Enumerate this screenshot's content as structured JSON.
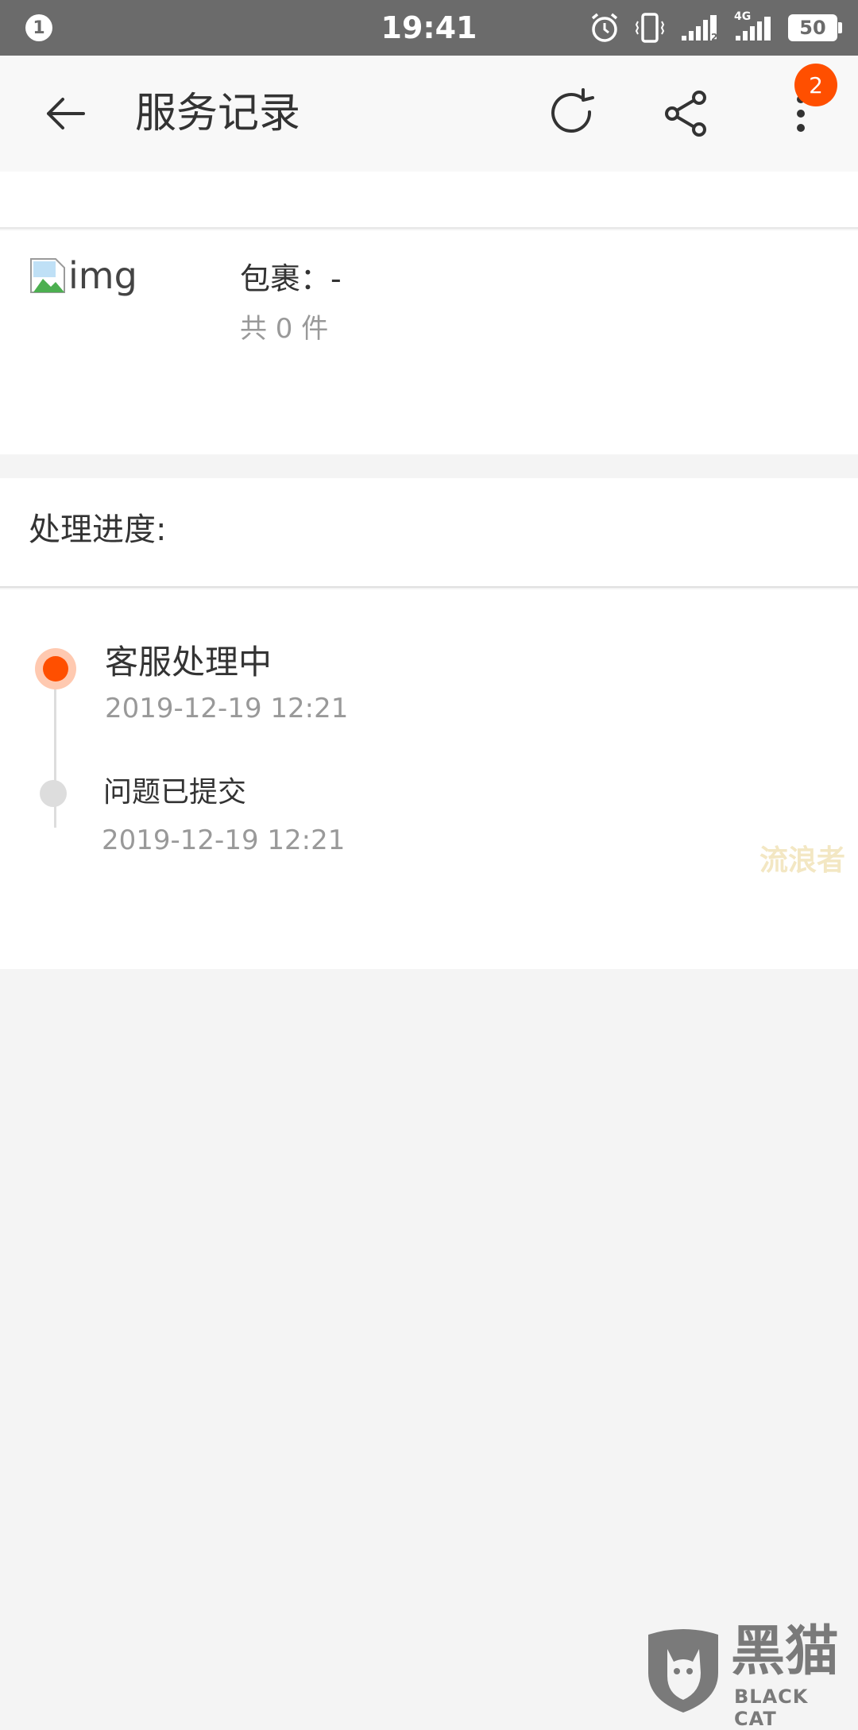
{
  "status_bar": {
    "notification_count": "1",
    "time": "19:41",
    "network_label": "4G",
    "battery": "50",
    "icons": [
      "alarm-icon",
      "vibrate-icon",
      "signal-icon",
      "signal-4g-icon",
      "battery-icon"
    ]
  },
  "header": {
    "title": "服务记录",
    "badge_count": "2",
    "icons": [
      "back-arrow-icon",
      "refresh-icon",
      "share-icon",
      "more-vertical-icon"
    ]
  },
  "package": {
    "image_alt": "img",
    "title": "包裹：-",
    "count": "共 0 件"
  },
  "progress": {
    "label": "处理进度:",
    "steps": [
      {
        "title": "客服处理中",
        "time": "2019-12-19 12:21",
        "active": true
      },
      {
        "title": "问题已提交",
        "time": "2019-12-19 12:21",
        "active": false
      }
    ]
  },
  "watermarks": {
    "small": "流浪者",
    "logo_main": "黑猫",
    "logo_sub": "BLACK CAT"
  },
  "colors": {
    "accent": "#ff4f00",
    "status_bar": "#6b6b6b",
    "text_primary": "#333333",
    "text_secondary": "#999999"
  }
}
